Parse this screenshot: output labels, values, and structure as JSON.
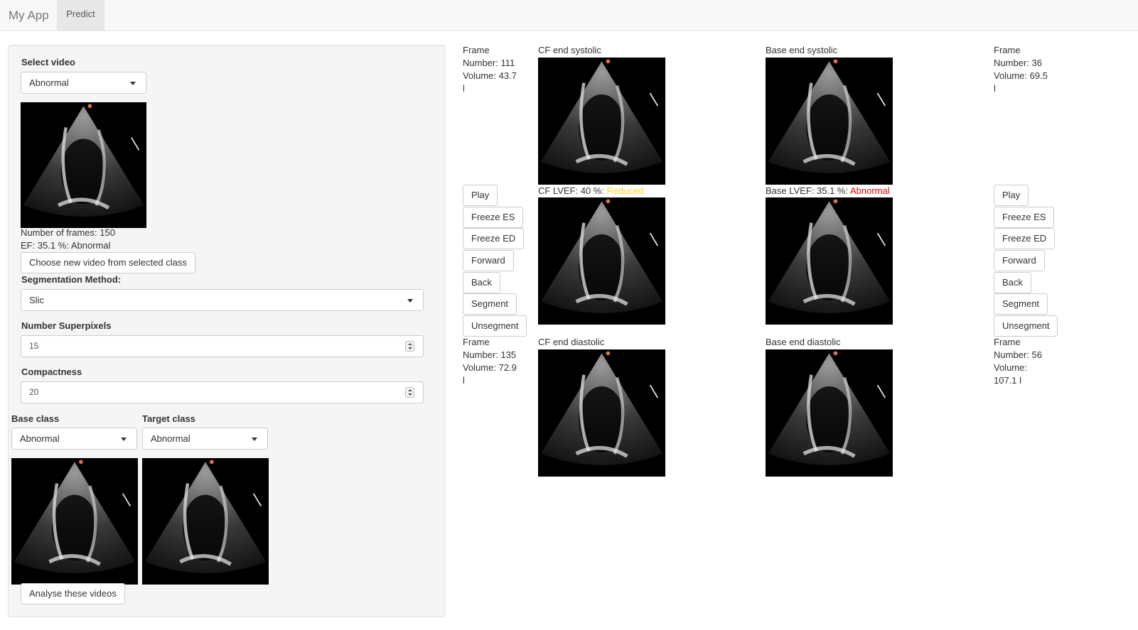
{
  "navbar": {
    "brand": "My App",
    "tab_predict": "Predict"
  },
  "sidebar": {
    "select_video_label": "Select video",
    "select_video_value": "Abnormal",
    "frames_text": "Number of frames: 150",
    "ef_text": "EF: 35.1 %: Abnormal",
    "choose_button": "Choose new video from selected class",
    "seg_method_label": "Segmentation Method:",
    "seg_method_value": "Slic",
    "superpixels_label": "Number Superpixels",
    "superpixels_value": "15",
    "compactness_label": "Compactness",
    "compactness_value": "20",
    "base_class_label": "Base class",
    "base_class_value": "Abnormal",
    "target_class_label": "Target class",
    "target_class_value": "Abnormal",
    "analyse_button": "Analyse these videos"
  },
  "left_panel": {
    "top_info": [
      "Frame",
      "Number: 111",
      "Volume: 43.7",
      "l"
    ],
    "buttons": [
      "Play",
      "Freeze ES",
      "Freeze ED",
      "Forward",
      "Back",
      "Segment",
      "Unsegment"
    ],
    "bottom_info": [
      "Frame",
      "Number: 135",
      "Volume: 72.9",
      "l"
    ]
  },
  "cf": {
    "es_label": "CF end systolic",
    "lvef_prefix": "CF LVEF: 40 %: ",
    "lvef_status": "Reduced",
    "ed_label": "CF end diastolic"
  },
  "base": {
    "es_label": "Base end systolic",
    "lvef_prefix": "Base LVEF: 35.1 %: ",
    "lvef_status": "Abnormal",
    "ed_label": "Base end diastolic"
  },
  "right_panel": {
    "top_info": [
      "Frame",
      "Number: 36",
      "Volume: 69.5",
      "l"
    ],
    "buttons": [
      "Play",
      "Freeze ES",
      "Freeze ED",
      "Forward",
      "Back",
      "Segment",
      "Unsegment"
    ],
    "bottom_info": [
      "Frame",
      "Number: 56",
      "Volume:",
      "107.1 l"
    ]
  },
  "colors": {
    "reduced": "#ffd21f",
    "abnormal": "#e00000"
  }
}
